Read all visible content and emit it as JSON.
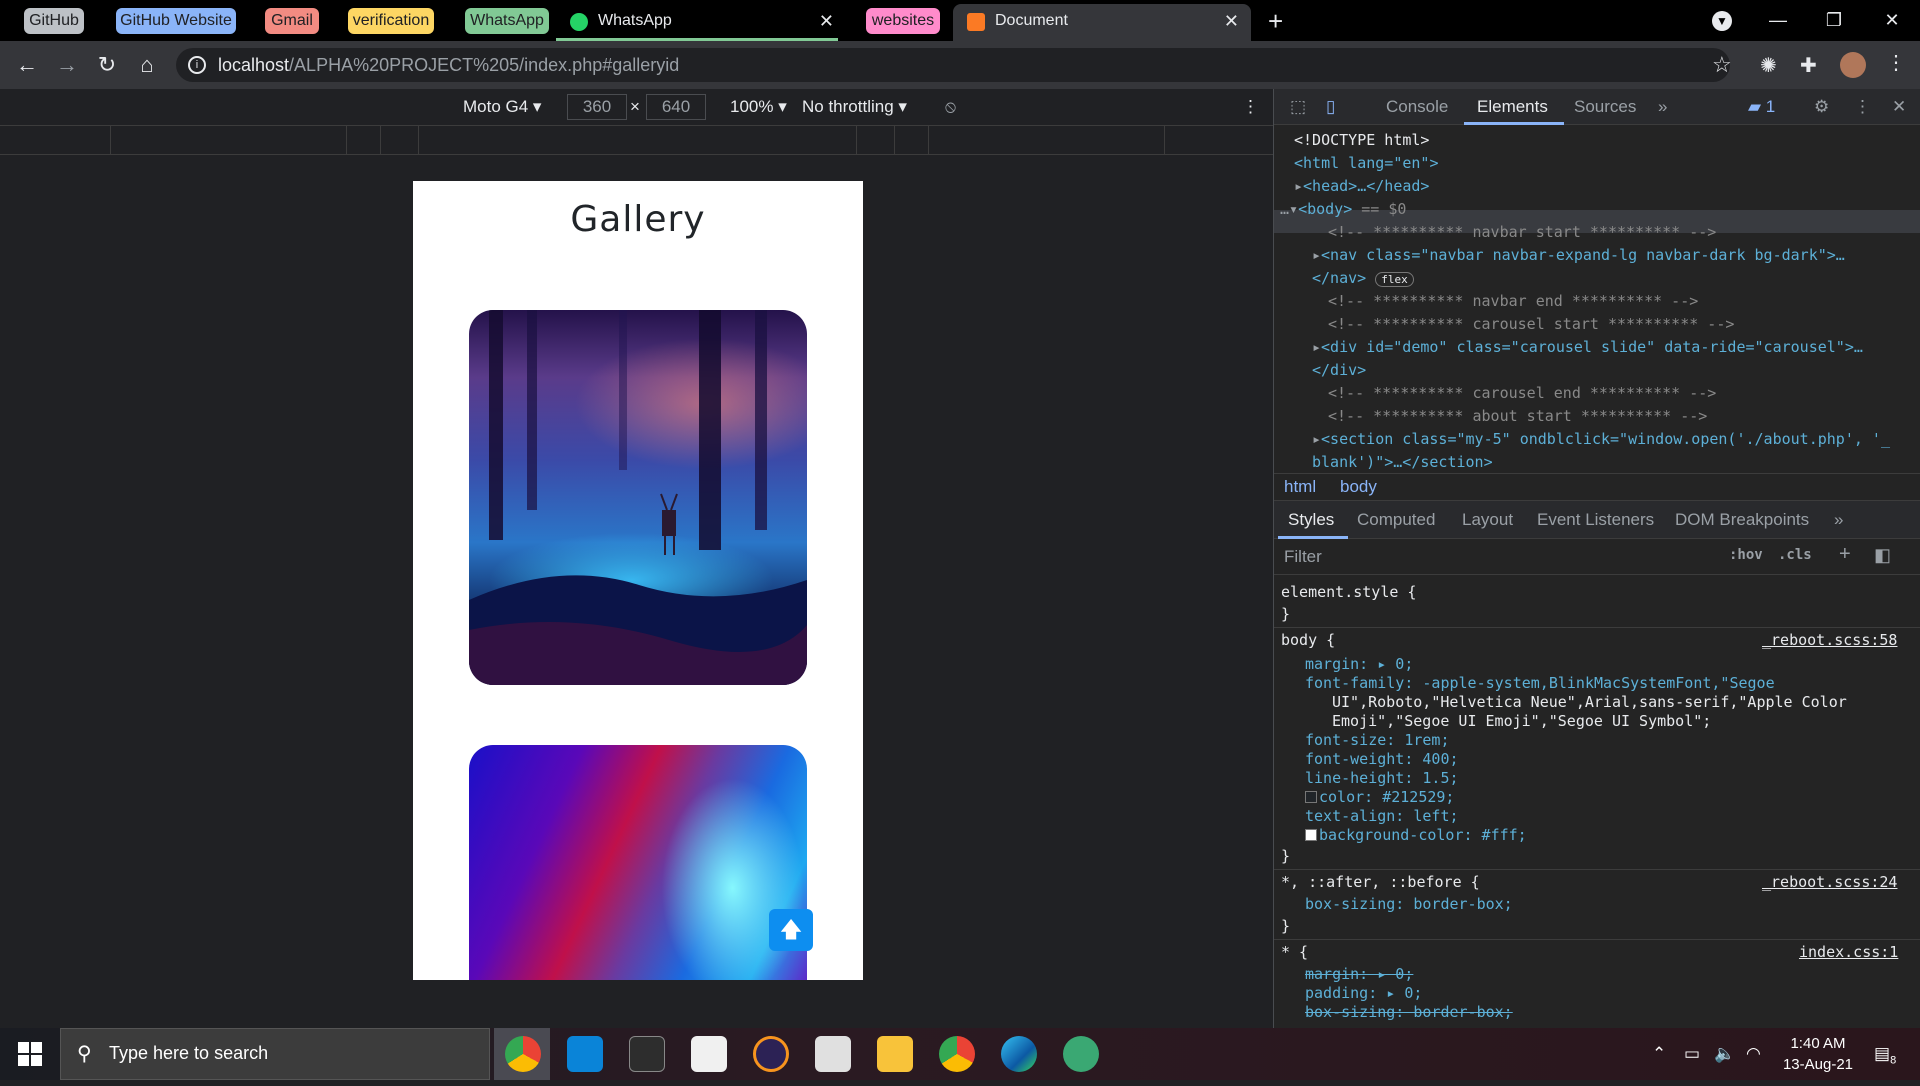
{
  "browser": {
    "tab_groups": [
      {
        "label": "GitHub",
        "color": "#bdc1c6",
        "text": "#202124"
      },
      {
        "label": "GitHub Website",
        "color": "#8ab4f8",
        "text": "#202124"
      },
      {
        "label": "Gmail",
        "color": "#f28b82",
        "text": "#202124"
      },
      {
        "label": "verification",
        "color": "#fdd663",
        "text": "#202124"
      },
      {
        "label": "WhatsApp",
        "color": "#81c995",
        "text": "#202124"
      },
      {
        "label": "websites",
        "color": "#ff8bcb",
        "text": "#202124"
      }
    ],
    "tabs": [
      {
        "title": "WhatsApp",
        "icon": "whatsapp-icon"
      },
      {
        "title": "Document",
        "icon": "xampp-icon",
        "active": true
      }
    ],
    "url_host": "localhost",
    "url_path": "/ALPHA%20PROJECT%205/index.php#galleryid"
  },
  "device_toolbar": {
    "device": "Moto G4",
    "width": "360",
    "times": "×",
    "height": "640",
    "zoom": "100%",
    "throttling": "No throttling"
  },
  "page": {
    "title": "Gallery",
    "scroll_top_icon": "arrow-up-icon"
  },
  "devtools": {
    "tabs": [
      "Console",
      "Elements",
      "Sources"
    ],
    "active_tab": "Elements",
    "issues_count": "1",
    "breadcrumbs": [
      "html",
      "body"
    ],
    "style_tabs": [
      "Styles",
      "Computed",
      "Layout",
      "Event Listeners",
      "DOM Breakpoints"
    ],
    "filter_placeholder": "Filter",
    "hov": ":hov",
    "cls": ".cls",
    "dom": {
      "doctype": "<!DOCTYPE html>",
      "html_open": "<html lang=\"en\">",
      "head": "<head>…</head>",
      "body_open": "<body>",
      "body_eq": "== $0",
      "c1": "<!-- ********** navbar start ********** -->",
      "nav_line": "<nav class=\"navbar navbar-expand-lg navbar-dark bg-dark\">…",
      "nav_close": "</nav>",
      "flex_badge": "flex",
      "c2": "<!-- ********** navbar end ********** -->",
      "c3": "<!-- ********** carousel start ********** -->",
      "div_line": "<div id=\"demo\" class=\"carousel slide\" data-ride=\"carousel\">…",
      "div_close": "</div>",
      "c4": "<!-- ********** carousel end ********** -->",
      "c5": "<!-- ********** about start ********** -->",
      "section_line": "<section class=\"my-5\" ondblclick=\"window.open('./about.php', '_",
      "section_cont": "blank')\">…</section>"
    },
    "rules": {
      "element_style": "element.style {",
      "close": "}",
      "body_sel": "body {",
      "body_src": "_reboot.scss:58",
      "margin": "margin: ▸ 0;",
      "ff1": "font-family: -apple-system,BlinkMacSystemFont,\"Segoe",
      "ff2": "UI\",Roboto,\"Helvetica Neue\",Arial,sans-serif,\"Apple Color",
      "ff3": "Emoji\",\"Segoe UI Emoji\",\"Segoe UI Symbol\";",
      "fs": "font-size: 1rem;",
      "fw": "font-weight: 400;",
      "lh": "line-height: 1.5;",
      "color": "color: #212529;",
      "ta": "text-align: left;",
      "bg": "background-color: #fff;",
      "univ_sel": "*, ::after, ::before {",
      "univ_src": "_reboot.scss:24",
      "bs": "box-sizing: border-box;",
      "star_sel": "* {",
      "star_src": "index.css:1",
      "s_margin": "margin: ▸ 0;",
      "s_padding": "padding: ▸ 0;",
      "s_bs": "box-sizing: border-box;",
      "color_swatch": "#212529",
      "bg_swatch": "#ffffff"
    }
  },
  "taskbar": {
    "search_placeholder": "Type here to search",
    "time": "1:40 AM",
    "date": "13-Aug-21",
    "notifications": "8"
  }
}
